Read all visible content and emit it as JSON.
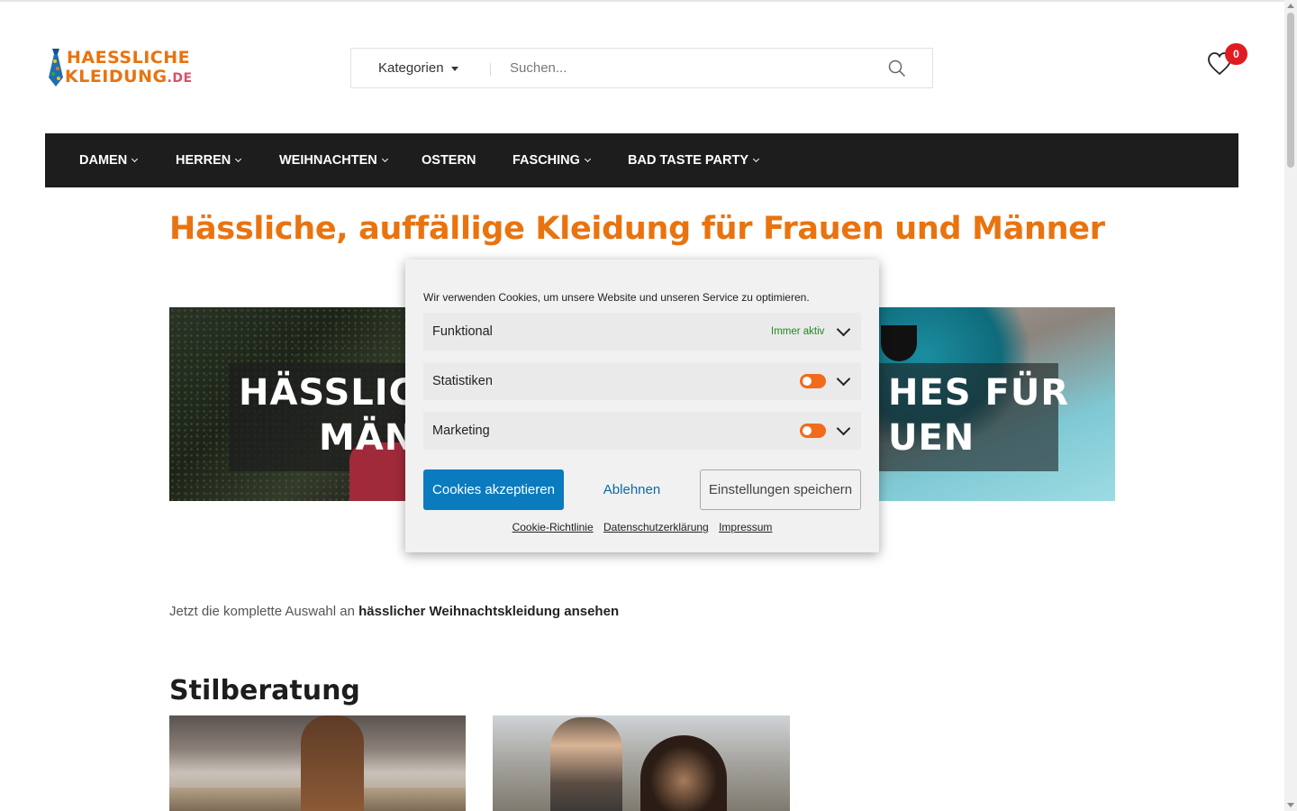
{
  "logo": {
    "line1": "HAESSLICHE",
    "line2": "KLEIDUNG",
    "tld": ".DE",
    "accent": "#e9730f"
  },
  "search": {
    "category_label": "Kategorien",
    "placeholder": "Suchen..."
  },
  "wishlist": {
    "count": "0"
  },
  "nav": {
    "items": [
      {
        "label": "DAMEN"
      },
      {
        "label": "HERREN"
      },
      {
        "label": "WEIHNACHTEN"
      },
      {
        "label": "OSTERN"
      },
      {
        "label": "FASCHING"
      },
      {
        "label": "BAD TASTE PARTY"
      }
    ]
  },
  "page": {
    "title": "Hässliche, auffällige Kleidung für Frauen und Männer"
  },
  "banner": {
    "left_line1": "HÄSSLIC",
    "left_line2": "MÄN",
    "right_line1": "HES FÜR",
    "right_line2": "UEN"
  },
  "intro": {
    "text": "Jetzt die komplette Auswahl an ",
    "link": "hässlicher Weihnachtskleidung ansehen"
  },
  "section": {
    "heading": "Stilberatung"
  },
  "cookie": {
    "message": "Wir verwenden Cookies, um unsere Website und unseren Service zu optimieren.",
    "rows": [
      {
        "label": "Funktional",
        "status": "Immer aktiv"
      },
      {
        "label": "Statistiken"
      },
      {
        "label": "Marketing"
      }
    ],
    "accept": "Cookies akzeptieren",
    "deny": "Ablehnen",
    "save": "Einstellungen speichern",
    "links": [
      "Cookie-Richtlinie",
      "Datenschutzerklärung",
      "Impressum"
    ],
    "accent": "#0a7bbf",
    "toggle_color": "#f26a1b"
  }
}
